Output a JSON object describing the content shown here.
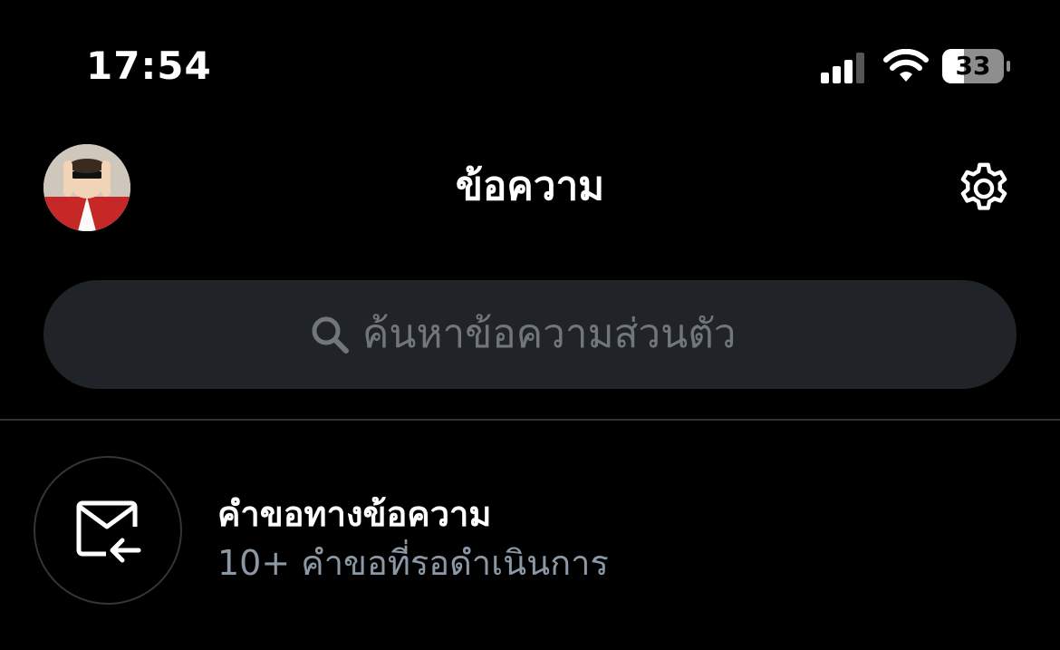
{
  "status_bar": {
    "time": "17:54",
    "battery": "33"
  },
  "header": {
    "title": "ข้อความ"
  },
  "search": {
    "placeholder": "ค้นหาข้อความส่วนตัว"
  },
  "message_requests": {
    "title": "คำขอทางข้อความ",
    "subtitle": "10+ คำขอที่รอดำเนินการ"
  },
  "icons": {
    "gear": "gear-icon",
    "search": "search-icon",
    "request": "mail-request-icon",
    "signal": "signal-icon",
    "wifi": "wifi-icon",
    "battery": "battery-icon"
  },
  "colors": {
    "background": "#000000",
    "search_bg": "#202327",
    "muted": "#71767b",
    "subtitle": "#8b98a5"
  }
}
